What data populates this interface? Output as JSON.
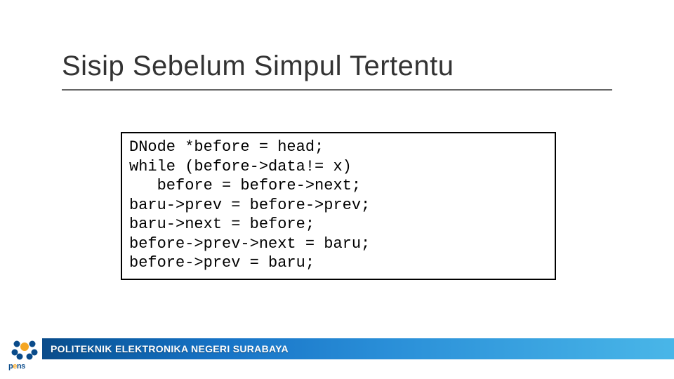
{
  "title": "Sisip Sebelum Simpul Tertentu",
  "code": {
    "l1": "DNode *before = head;",
    "l2": "while (before->data!= x)",
    "l3": "   before = before->next;",
    "l4": "baru->prev = before->prev;",
    "l5": "baru->next = before;",
    "l6": "before->prev->next = baru;",
    "l7": "before->prev = baru;"
  },
  "footer": "POLITEKNIK ELEKTRONIKA NEGERI SURABAYA",
  "logo": {
    "p1": "p",
    "p2": "e",
    "p3": "ns"
  }
}
